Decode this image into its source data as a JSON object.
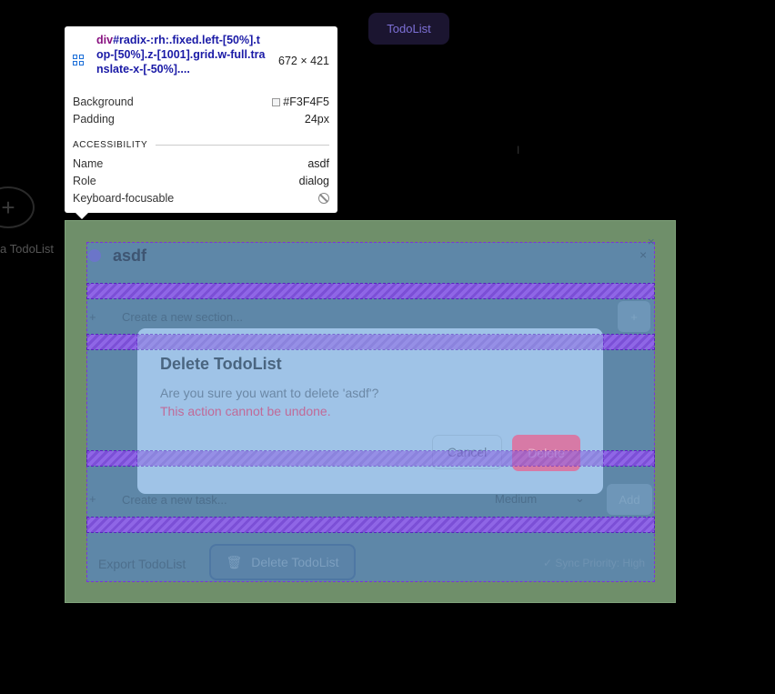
{
  "background_app": {
    "tab_label": "TodoList",
    "add_circle_glyph": "+",
    "sidebar_label": "a TodoList"
  },
  "inspector": {
    "tag": "div",
    "selector": "#radix-:rh:.fixed.left-[50%].top-[50%].z-[1001].grid.w-full.translate-x-[-50%]....",
    "dimensions": "672 × 421",
    "background_label": "Background",
    "background_value": "#F3F4F5",
    "padding_label": "Padding",
    "padding_value": "24px",
    "accessibility_title": "ACCESSIBILITY",
    "name_label": "Name",
    "name_value": "asdf",
    "role_label": "Role",
    "role_value": "dialog",
    "focusable_label": "Keyboard-focusable",
    "icon": "grid-icon"
  },
  "todolist_dialog": {
    "title": "asdf",
    "close_glyph": "×",
    "section_placeholder": "Create a new section...",
    "task_placeholder": "Create a new task...",
    "priority_value": "Medium",
    "add_label": "Add",
    "export_label": "Export TodoList",
    "delete_label": "Delete TodoList",
    "sync_label": "Sync Priority: High"
  },
  "confirm_dialog": {
    "title": "Delete TodoList",
    "message": "Are you sure you want to delete 'asdf'?",
    "warning": "This action cannot be undone.",
    "cancel_label": "Cancel",
    "delete_label": "Delete"
  },
  "colors": {
    "margin_highlight": "#6f8f6a",
    "content_highlight": "#5e87a8",
    "padding_stripe": "#7b4fd6",
    "danger": "#d77aa6"
  }
}
